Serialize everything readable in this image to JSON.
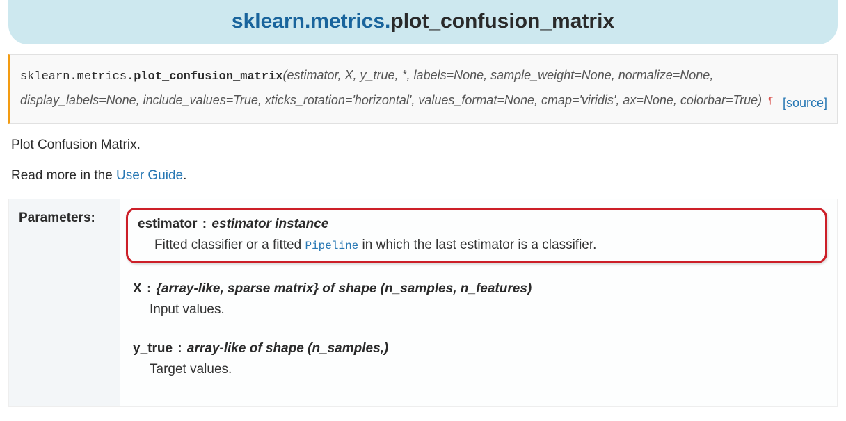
{
  "title": {
    "module_prefix": "sklearn.metrics",
    "dot": ".",
    "function": "plot_confusion_matrix"
  },
  "signature": {
    "module_path": "sklearn.metrics.",
    "function_name": "plot_confusion_matrix",
    "open": "(",
    "args": "estimator, X, y_true, *, labels=None, sample_weight=None, normalize=None, display_labels=None, include_values=True, xticks_rotation='horizontal', values_format=None, cmap='viridis', ax=None, colorbar=True",
    "close": ")",
    "pilcrow": "¶",
    "source_label": "[source]"
  },
  "description": {
    "line1": "Plot Confusion Matrix.",
    "read_more_prefix": "Read more in the ",
    "guide_link_text": "User Guide",
    "period": "."
  },
  "parameters": {
    "label": "Parameters:",
    "items": [
      {
        "name": "estimator",
        "type": "estimator instance",
        "desc_pre": "Fitted classifier or a fitted ",
        "pipeline": "Pipeline",
        "desc_post": " in which the last estimator is a classifier.",
        "highlight": true
      },
      {
        "name": "X",
        "type": "{array-like, sparse matrix} of shape (n_samples, n_features)",
        "desc": "Input values."
      },
      {
        "name": "y_true",
        "type": "array-like of shape (n_samples,)",
        "desc": "Target values."
      }
    ]
  }
}
